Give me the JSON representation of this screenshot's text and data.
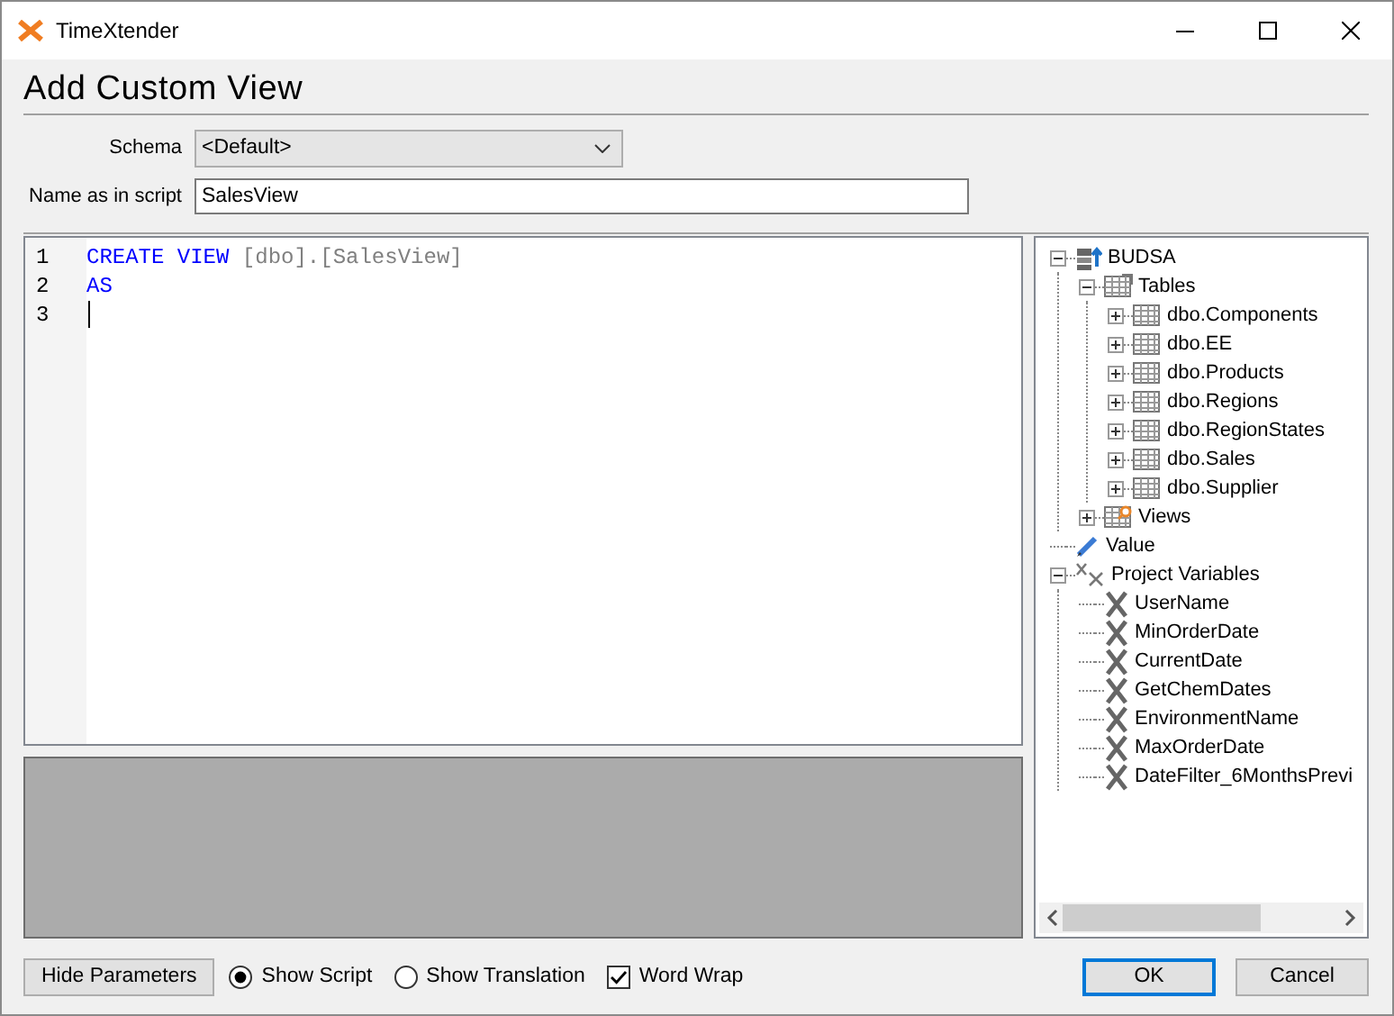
{
  "window": {
    "title": "TimeXtender"
  },
  "heading": "Add Custom View",
  "fields": [
    {
      "label": "Schema",
      "kind": "dropdown",
      "value": "<Default>"
    },
    {
      "label": "Name as in script",
      "kind": "text",
      "value": "SalesView"
    }
  ],
  "editor": {
    "lines": [
      {
        "number": "1",
        "cursor": false,
        "tokens": [
          {
            "text": "CREATE VIEW",
            "kind": "keyword"
          },
          {
            "text": "[dbo].[SalesView]",
            "kind": "identifier"
          }
        ]
      },
      {
        "number": "2",
        "cursor": false,
        "tokens": [
          {
            "text": "AS",
            "kind": "keyword"
          }
        ]
      },
      {
        "number": "3",
        "cursor": true
      }
    ]
  },
  "tree": {
    "items": [
      {
        "label": "BUDSA",
        "kind": "database",
        "expanded": true,
        "children": [
          {
            "label": "Tables",
            "kind": "table-folder",
            "expanded": true,
            "children": [
              {
                "label": "dbo.Components",
                "kind": "table",
                "expanded": false
              },
              {
                "label": "dbo.EE",
                "kind": "table",
                "expanded": false
              },
              {
                "label": "dbo.Products",
                "kind": "table",
                "expanded": false
              },
              {
                "label": "dbo.Regions",
                "kind": "table",
                "expanded": false
              },
              {
                "label": "dbo.RegionStates",
                "kind": "table",
                "expanded": false
              },
              {
                "label": "dbo.Sales",
                "kind": "table",
                "expanded": false
              },
              {
                "label": "dbo.Supplier",
                "kind": "table",
                "expanded": false
              }
            ]
          },
          {
            "label": "Views",
            "kind": "view-folder",
            "expanded": false
          }
        ]
      },
      {
        "label": "Value",
        "kind": "value"
      },
      {
        "label": "Project Variables",
        "kind": "variable-folder",
        "expanded": true,
        "children": [
          {
            "label": "UserName",
            "kind": "variable"
          },
          {
            "label": "MinOrderDate",
            "kind": "variable"
          },
          {
            "label": "CurrentDate",
            "kind": "variable"
          },
          {
            "label": "GetChemDates",
            "kind": "variable"
          },
          {
            "label": "EnvironmentName",
            "kind": "variable"
          },
          {
            "label": "MaxOrderDate",
            "kind": "variable"
          },
          {
            "label": "DateFilter_6MonthsPrevi",
            "kind": "variable"
          }
        ]
      }
    ]
  },
  "options": [
    {
      "kind": "button",
      "label": "Hide Parameters"
    },
    {
      "kind": "radio",
      "label": "Show Script",
      "selected": true
    },
    {
      "kind": "radio",
      "label": "Show Translation",
      "selected": false
    },
    {
      "kind": "checkbox",
      "label": "Word Wrap",
      "checked": true
    }
  ],
  "buttons": [
    {
      "label": "OK",
      "default": true
    },
    {
      "label": "Cancel",
      "default": false
    }
  ]
}
